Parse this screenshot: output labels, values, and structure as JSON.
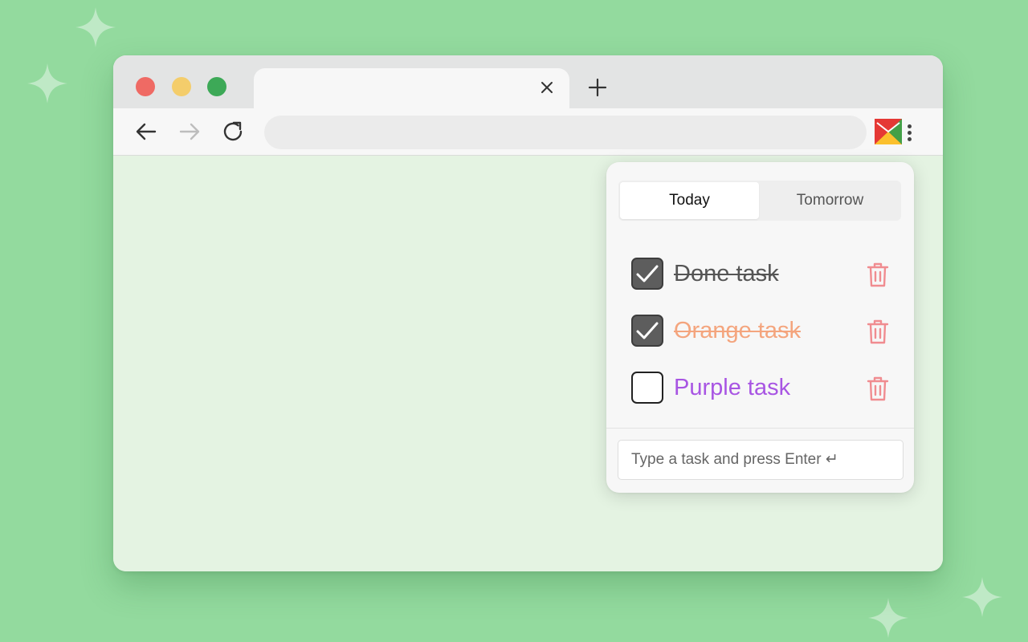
{
  "colors": {
    "background": "#93da9e",
    "page": "#e4f3e2",
    "traffic_close": "#ef6a64",
    "traffic_minimize": "#f4cd6b",
    "traffic_maximize": "#3da957",
    "task_orange": "#f4a57e",
    "task_purple": "#a855e3",
    "trash": "#f08c90"
  },
  "browser": {
    "tab_close_icon": "close-icon",
    "new_tab_icon": "plus-icon",
    "nav": {
      "back_icon": "arrow-left-icon",
      "forward_icon": "arrow-right-icon",
      "reload_icon": "reload-icon"
    },
    "address_value": "",
    "extension_icon": "todo-extension-icon",
    "menu_icon": "kebab-menu-icon"
  },
  "popup": {
    "tabs": [
      {
        "label": "Today",
        "active": true
      },
      {
        "label": "Tomorrow",
        "active": false
      }
    ],
    "tasks": [
      {
        "label": "Done task",
        "done": true,
        "color": "#555555"
      },
      {
        "label": "Orange task",
        "done": true,
        "color": "#f4a57e"
      },
      {
        "label": "Purple task",
        "done": false,
        "color": "#a855e3"
      }
    ],
    "input_placeholder": "Type a task and press Enter ↵"
  }
}
